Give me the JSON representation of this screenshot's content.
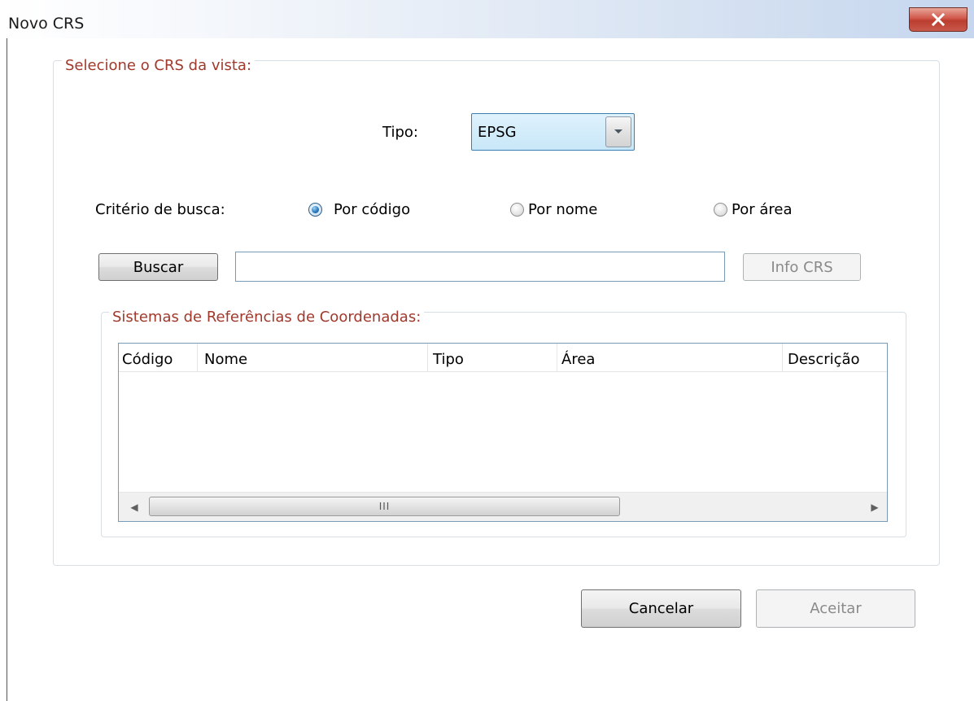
{
  "window": {
    "title": "Novo CRS",
    "close_icon": "close-x-icon"
  },
  "crs_group": {
    "legend": "Selecione o CRS da vista:",
    "tipo_label": "Tipo:",
    "tipo_value": "EPSG",
    "criteria_label": "Critério de busca:",
    "radios": [
      {
        "label": "Por código",
        "checked": true
      },
      {
        "label": "Por nome",
        "checked": false
      },
      {
        "label": "Por área",
        "checked": false
      }
    ],
    "search_button": "Buscar",
    "search_value": "",
    "info_button": "Info CRS"
  },
  "ref_group": {
    "legend": "Sistemas de Referências de Coordenadas:",
    "columns": [
      "Código",
      "Nome",
      "Tipo",
      "Área",
      "Descrição"
    ],
    "rows": [],
    "scroll_grip": "III"
  },
  "footer": {
    "cancel_button": "Cancelar",
    "accept_button": "Aceitar"
  },
  "colors": {
    "legend_text": "#a0392c",
    "combo_bg": "#c8e7f8",
    "close_button": "#c8594b"
  }
}
